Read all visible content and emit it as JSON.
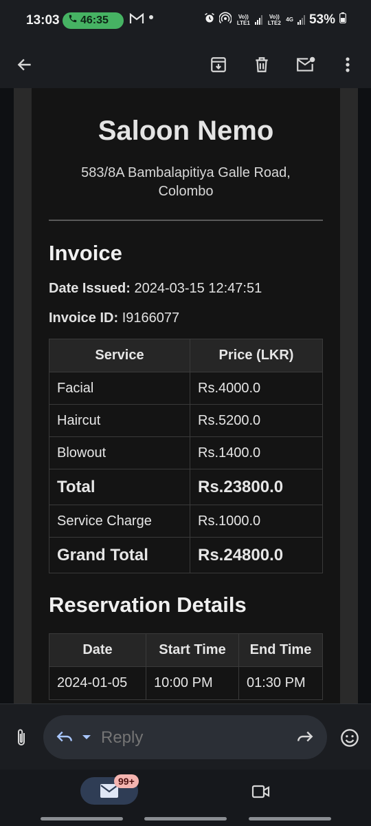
{
  "status_bar": {
    "time": "13:03",
    "call_timer": "46:35",
    "lte1": "Vo)) LTE1",
    "lte2": "Vo)) LTE2",
    "network": "4G",
    "battery": "53%"
  },
  "app_bar": {
    "icons": [
      "back-arrow-icon",
      "archive-icon",
      "delete-icon",
      "mark-unread-icon",
      "more-vert-icon"
    ]
  },
  "email": {
    "salon_name": "Saloon Nemo",
    "address_line1": "583/8A Bambalapitiya Galle Road,",
    "address_line2": "Colombo",
    "invoice_title": "Invoice",
    "date_label": "Date Issued:",
    "date_value": "2024-03-15 12:47:51",
    "invoice_id_label": "Invoice ID:",
    "invoice_id_value": "I9166077",
    "services_table": {
      "headers": [
        "Service",
        "Price (LKR)"
      ],
      "rows": [
        {
          "service": "Facial",
          "price": "Rs.4000.0"
        },
        {
          "service": "Haircut",
          "price": "Rs.5200.0"
        },
        {
          "service": "Blowout",
          "price": "Rs.1400.0"
        }
      ],
      "total_label": "Total",
      "total_value": "Rs.23800.0",
      "service_charge_label": "Service Charge",
      "service_charge_value": "Rs.1000.0",
      "grand_total_label": "Grand Total",
      "grand_total_value": "Rs.24800.0"
    },
    "reservation_title": "Reservation Details",
    "reservation_table": {
      "headers": [
        "Date",
        "Start Time",
        "End Time"
      ],
      "rows": [
        {
          "date": "2024-01-05",
          "start": "10:00 PM",
          "end": "01:30 PM"
        }
      ]
    }
  },
  "reply_bar": {
    "placeholder": "Reply"
  },
  "bottom_nav": {
    "mail_badge": "99+"
  },
  "colors": {
    "call_pill": "#46b363",
    "badge": "#f4b4b0",
    "mail_tab": "#2f3d55",
    "background": "#0e1013"
  }
}
